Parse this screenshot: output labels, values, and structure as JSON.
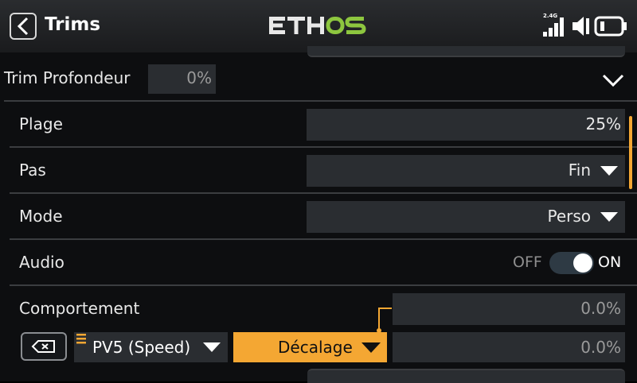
{
  "header": {
    "title": "Trims",
    "logo_text": "ETHOS",
    "radio_band": "2.4G",
    "accent_color": "#f4a733",
    "logo_accent_color": "#8dc63f"
  },
  "section": {
    "label": "Trim Profondeur",
    "value": "0%"
  },
  "rows": {
    "plage": {
      "label": "Plage",
      "value": "25%"
    },
    "pas": {
      "label": "Pas",
      "value": "Fin"
    },
    "mode": {
      "label": "Mode",
      "value": "Perso"
    },
    "audio": {
      "label": "Audio",
      "off_label": "OFF",
      "on_label": "ON",
      "state": "on"
    },
    "comportement": {
      "label": "Comportement",
      "top_value": "0.0%",
      "source": "PV5 (Speed)",
      "behavior": "Décalage",
      "bottom_value": "0.0%"
    }
  }
}
